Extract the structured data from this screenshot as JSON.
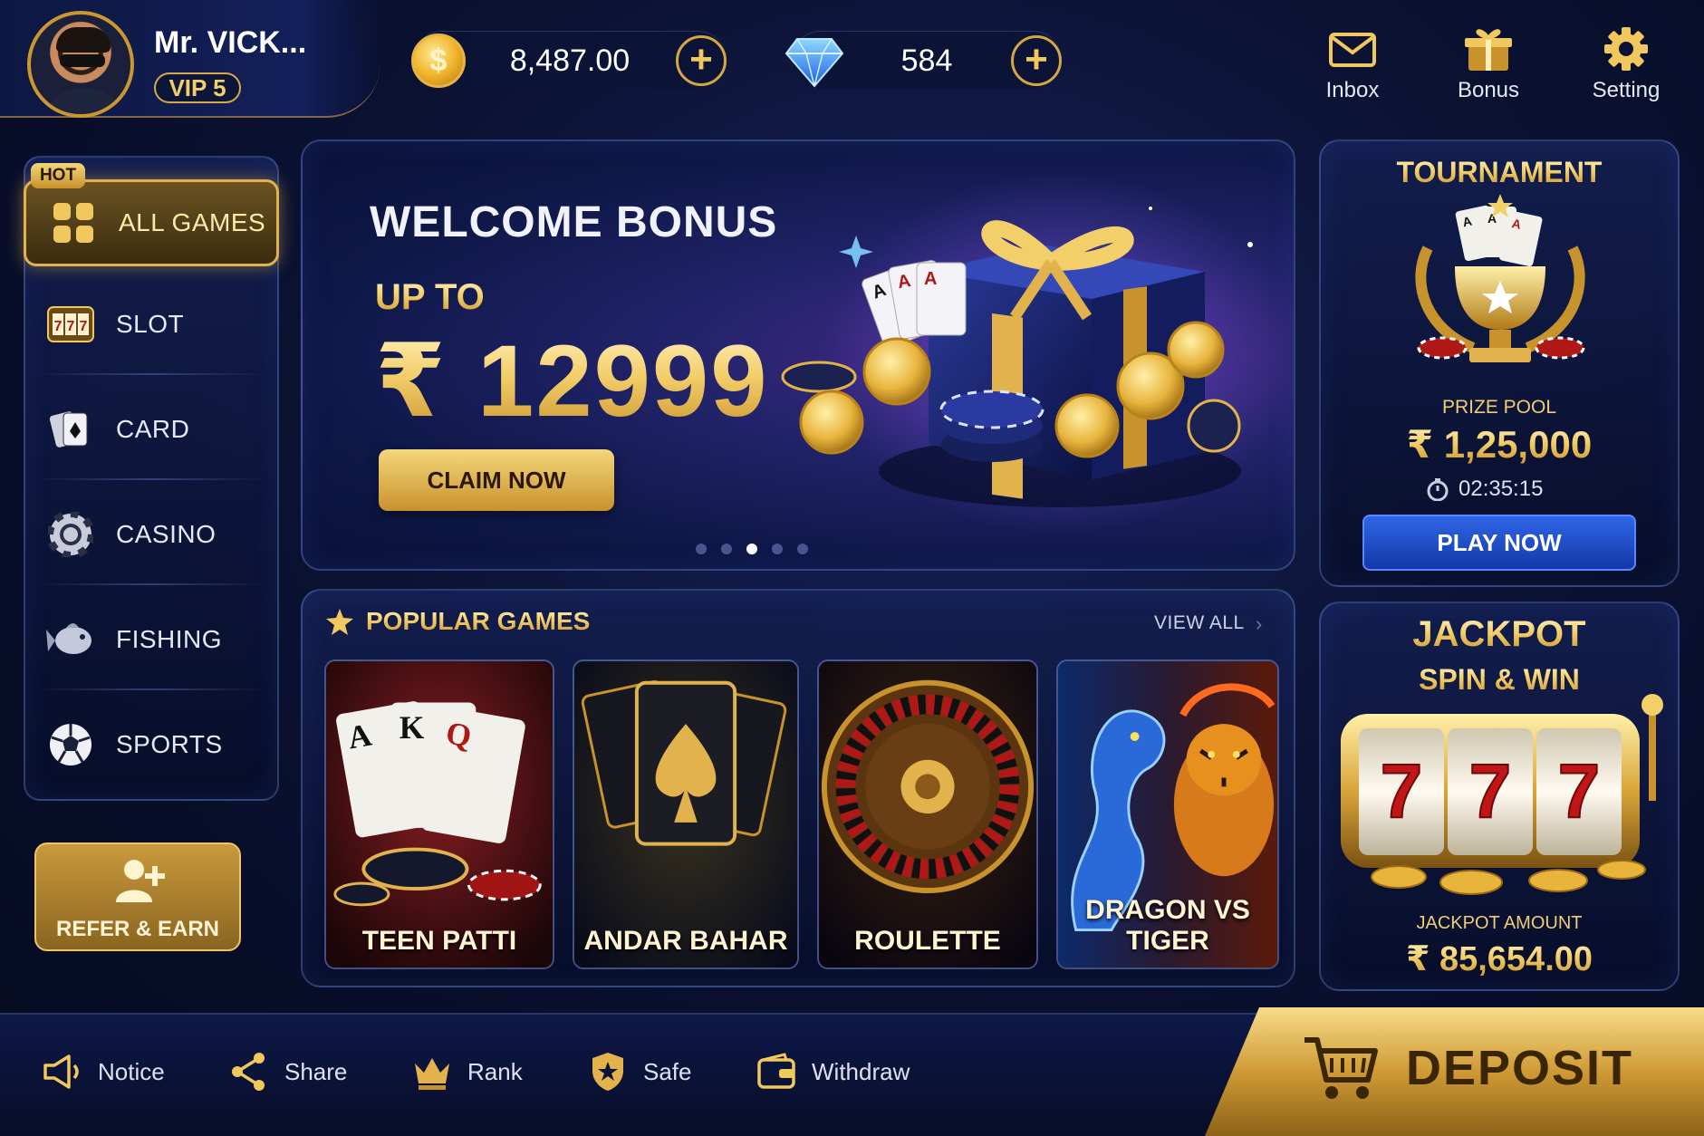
{
  "profile": {
    "name": "Mr. VICK...",
    "vip": "VIP 5"
  },
  "currencies": {
    "coins": {
      "icon": "coin-icon",
      "value": "8,487.00",
      "add": "+"
    },
    "gems": {
      "icon": "diamond-icon",
      "value": "584",
      "add": "+"
    }
  },
  "top_actions": [
    {
      "icon": "inbox-icon",
      "label": "Inbox"
    },
    {
      "icon": "gift-icon",
      "label": "Bonus"
    },
    {
      "icon": "gear-icon",
      "label": "Setting"
    }
  ],
  "sidebar": {
    "hot_tag": "HOT",
    "items": [
      {
        "icon": "grid-icon",
        "label": "ALL GAMES",
        "active": true
      },
      {
        "icon": "slot-icon",
        "label": "SLOT"
      },
      {
        "icon": "card-icon",
        "label": "CARD"
      },
      {
        "icon": "casino-chip-icon",
        "label": "CASINO"
      },
      {
        "icon": "fish-icon",
        "label": "FISHING"
      },
      {
        "icon": "soccer-ball-icon",
        "label": "SPORTS"
      }
    ],
    "refer": {
      "icon": "add-user-icon",
      "label": "REFER & EARN"
    }
  },
  "banner": {
    "title": "WELCOME BONUS",
    "subtitle": "UP TO",
    "amount": "₹ 12999",
    "cta": "CLAIM NOW",
    "slide_count": 5,
    "active_slide": 3
  },
  "popular": {
    "title": "POPULAR GAMES",
    "view_all": "VIEW ALL",
    "arrow": "›",
    "games": [
      {
        "name": "TEEN PATTI"
      },
      {
        "name": "ANDAR BAHAR"
      },
      {
        "name": "ROULETTE"
      },
      {
        "name": "DRAGON VS TIGER"
      }
    ]
  },
  "tournament": {
    "title": "TOURNAMENT",
    "prize_label": "PRIZE POOL",
    "prize_value": "₹ 1,25,000",
    "timer": "02:35:15",
    "cta": "PLAY NOW"
  },
  "jackpot": {
    "title": "JACKPOT",
    "subtitle": "SPIN & WIN",
    "reels": [
      "7",
      "7",
      "7"
    ],
    "amount_label": "JACKPOT AMOUNT",
    "amount": "₹ 85,654.00"
  },
  "bottom_nav": [
    {
      "icon": "megaphone-icon",
      "label": "Notice"
    },
    {
      "icon": "share-icon",
      "label": "Share"
    },
    {
      "icon": "crown-icon",
      "label": "Rank"
    },
    {
      "icon": "shield-icon",
      "label": "Safe"
    },
    {
      "icon": "wallet-icon",
      "label": "Withdraw"
    }
  ],
  "deposit": {
    "icon": "cart-icon",
    "label": "DEPOSIT"
  },
  "colors": {
    "gold": "#e2b24c",
    "navy": "#0b1233",
    "blue_button": "#1f4fd0"
  }
}
